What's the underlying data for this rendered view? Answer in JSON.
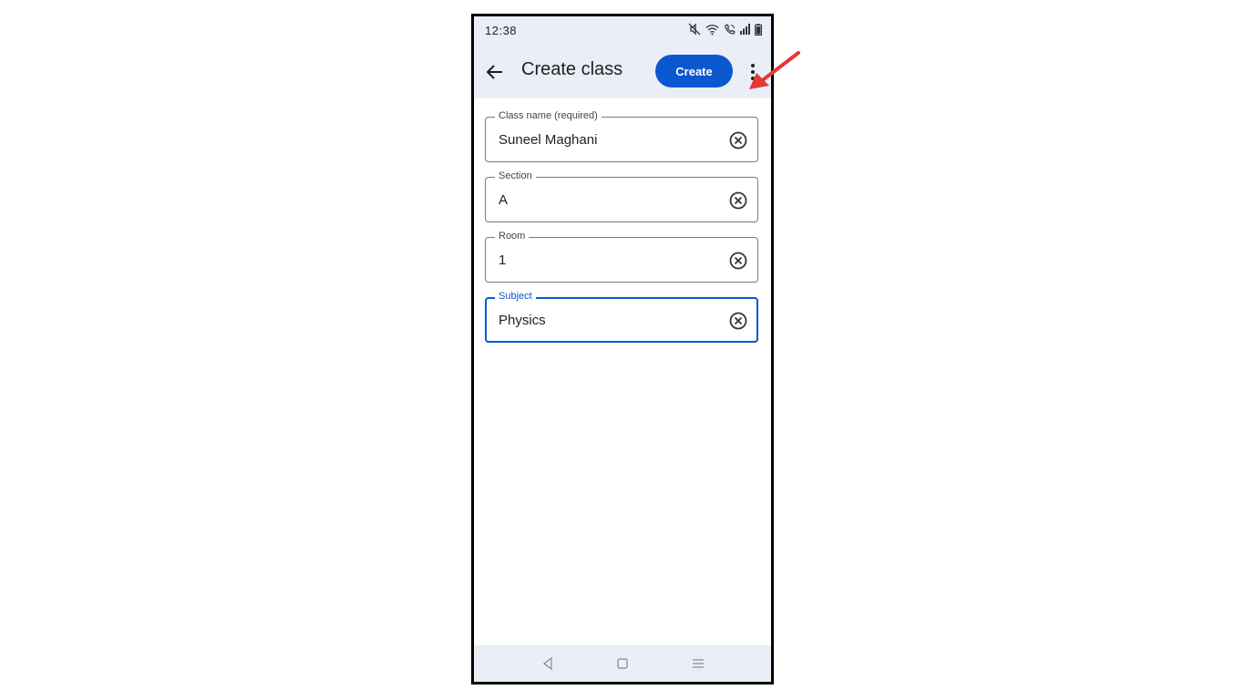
{
  "status_bar": {
    "time": "12:38",
    "icons": [
      "mute-icon",
      "wifi-icon",
      "wifi-call-icon",
      "signal-icon",
      "battery-icon"
    ]
  },
  "app_bar": {
    "title": "Create class",
    "create_label": "Create",
    "back_icon": "arrow-back-icon",
    "more_icon": "more-vert-icon"
  },
  "form": {
    "fields": [
      {
        "label": "Class name (required)",
        "value": "Suneel Maghani"
      },
      {
        "label": "Section",
        "value": "A"
      },
      {
        "label": "Room",
        "value": "1"
      },
      {
        "label": "Subject",
        "value": "Physics"
      }
    ]
  },
  "nav_bar": {
    "icons": [
      "nav-back-icon",
      "nav-home-icon",
      "nav-recents-icon"
    ]
  },
  "colors": {
    "accent": "#0b57d0",
    "app_bar_bg": "#e9eef7",
    "annotation_arrow": "#e53935"
  }
}
